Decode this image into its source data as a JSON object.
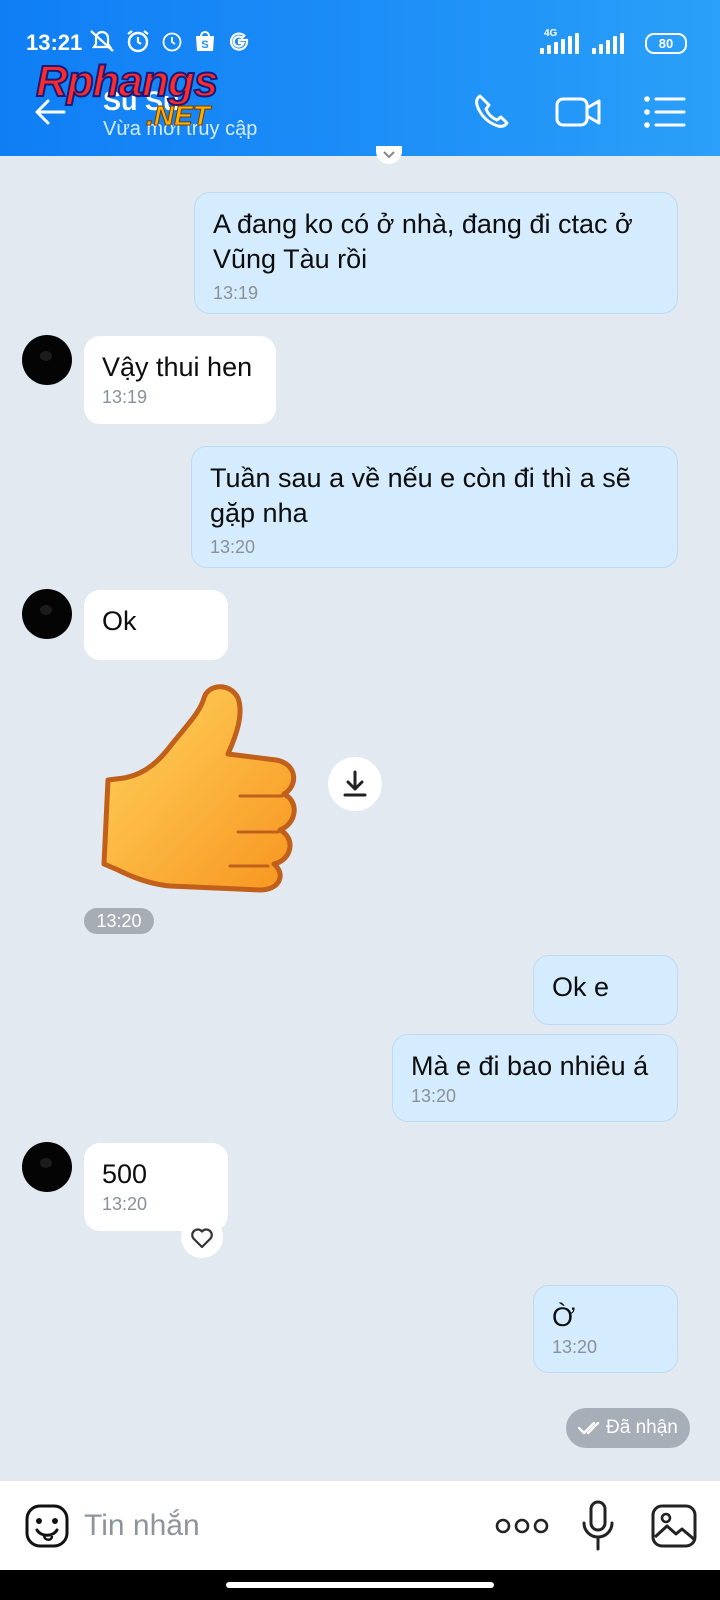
{
  "status_bar": {
    "time": "13:21",
    "network": "4G",
    "battery": "80"
  },
  "header": {
    "contact_name": "Su Su",
    "contact_status": "Vừa mới truy cập",
    "watermark_main": "Rphangs",
    "watermark_sub": ".NET"
  },
  "messages": [
    {
      "dir": "out",
      "text_lines": [
        "A đang ko có ở nhà, đang đi ctac ở",
        "Vũng Tàu rồi"
      ],
      "time": "13:19"
    },
    {
      "dir": "in",
      "text_lines": [
        "Vậy thui hen"
      ],
      "time": "13:19"
    },
    {
      "dir": "out",
      "text_lines": [
        "Tuần sau a về nếu e còn đi thì  a sẽ",
        "gặp nha"
      ],
      "time": "13:20"
    },
    {
      "dir": "in",
      "text_lines": [
        "Ok"
      ],
      "time": ""
    },
    {
      "dir": "in",
      "sticker": "thumbs-up",
      "time": "13:20"
    },
    {
      "dir": "out",
      "text_lines": [
        "Ok e"
      ],
      "time": ""
    },
    {
      "dir": "out",
      "text_lines": [
        "Mà e đi bao nhiêu á"
      ],
      "time": "13:20"
    },
    {
      "dir": "in",
      "text_lines": [
        "500"
      ],
      "time": "13:20"
    },
    {
      "dir": "out",
      "text_lines": [
        "Ờ"
      ],
      "time": "13:20"
    }
  ],
  "received_status": "Đã nhận",
  "composer": {
    "placeholder": "Tin nhắn"
  },
  "icons": [
    "back-arrow-icon",
    "phone-icon",
    "video-call-icon",
    "menu-list-icon",
    "download-icon",
    "heart-icon",
    "double-check-icon",
    "emoji-icon",
    "more-icon",
    "microphone-icon",
    "image-icon"
  ],
  "colors": {
    "header_blue": "#1d8ff7",
    "outgoing_bubble": "#d5ecfe",
    "incoming_bubble": "#ffffff",
    "chat_background": "#e2e9f1"
  }
}
